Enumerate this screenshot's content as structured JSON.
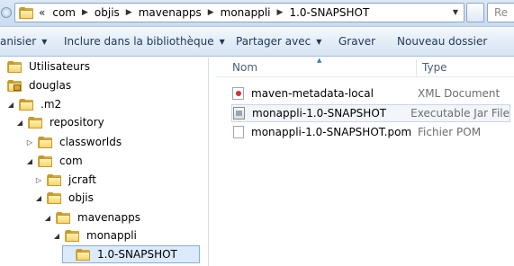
{
  "address_bar": {
    "overflow_chevron": "«",
    "crumbs": [
      "com",
      "objis",
      "mavenapps",
      "monappli",
      "1.0-SNAPSHOT"
    ],
    "search_placeholder": "Re"
  },
  "toolbar": {
    "organize": "anisier",
    "include": "Inclure dans la bibliothèque",
    "share": "Partager avec",
    "burn": "Graver",
    "new_folder": "Nouveau dossier"
  },
  "tree": [
    {
      "label": "Utilisateurs",
      "expanded": true,
      "level": 0
    },
    {
      "label": "douglas",
      "expanded": true,
      "level": 1,
      "locked": true
    },
    {
      "label": ".m2",
      "expanded": true,
      "level": 2
    },
    {
      "label": "repository",
      "expanded": true,
      "level": 3
    },
    {
      "label": "classworlds",
      "expanded": false,
      "level": 4
    },
    {
      "label": "com",
      "expanded": true,
      "level": 4
    },
    {
      "label": "jcraft",
      "expanded": false,
      "level": 5
    },
    {
      "label": "objis",
      "expanded": true,
      "level": 5
    },
    {
      "label": "mavenapps",
      "expanded": true,
      "level": 6
    },
    {
      "label": "monappli",
      "expanded": true,
      "level": 7
    },
    {
      "label": "1.0-SNAPSHOT",
      "expanded": null,
      "level": 8,
      "selected": true
    }
  ],
  "file_list": {
    "columns": {
      "name": "Nom",
      "type": "Type"
    },
    "files": [
      {
        "name": "maven-metadata-local",
        "type": "XML Document",
        "icon": "xml-file-icon"
      },
      {
        "name": "monappli-1.0-SNAPSHOT",
        "type": "Executable Jar File",
        "icon": "jar-file-icon"
      },
      {
        "name": "monappli-1.0-SNAPSHOT.pom",
        "type": "Fichier POM",
        "icon": "pom-file-icon"
      }
    ]
  }
}
